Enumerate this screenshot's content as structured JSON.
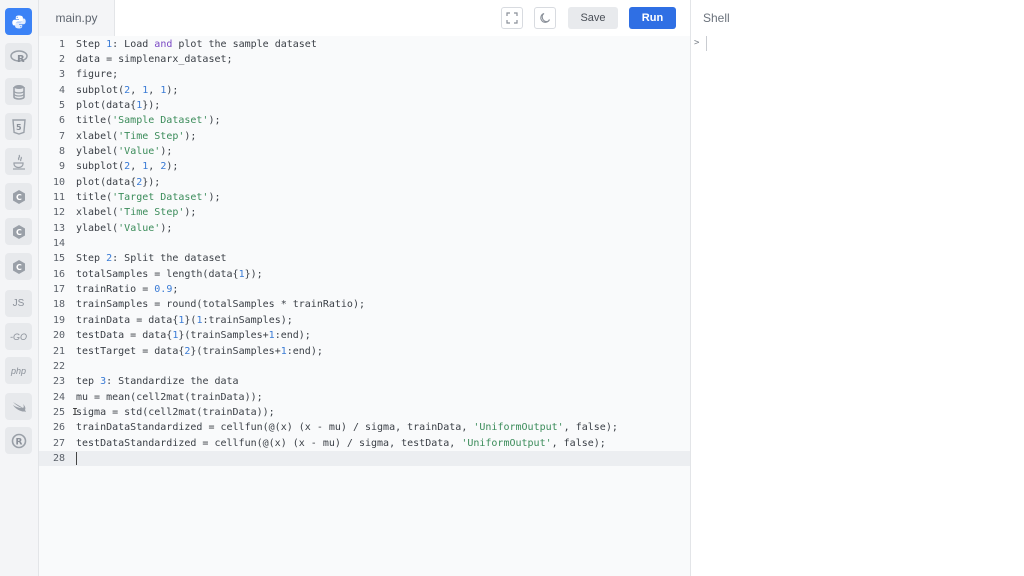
{
  "editor": {
    "file_tab": "main.py",
    "save_label": "Save",
    "run_label": "Run",
    "lines": [
      {
        "n": "1",
        "segs": [
          {
            "t": "Step "
          },
          {
            "t": "1",
            "c": "num"
          },
          {
            "t": ": Load "
          },
          {
            "t": "and",
            "c": "kw"
          },
          {
            "t": " plot the sample dataset"
          }
        ]
      },
      {
        "n": "2",
        "segs": [
          {
            "t": "data = simplenarx_dataset;"
          }
        ]
      },
      {
        "n": "3",
        "segs": [
          {
            "t": "figure;"
          }
        ]
      },
      {
        "n": "4",
        "segs": [
          {
            "t": "subplot("
          },
          {
            "t": "2",
            "c": "num"
          },
          {
            "t": ", "
          },
          {
            "t": "1",
            "c": "num"
          },
          {
            "t": ", "
          },
          {
            "t": "1",
            "c": "num"
          },
          {
            "t": ");"
          }
        ]
      },
      {
        "n": "5",
        "segs": [
          {
            "t": "plot(data{"
          },
          {
            "t": "1",
            "c": "num"
          },
          {
            "t": "});"
          }
        ]
      },
      {
        "n": "6",
        "segs": [
          {
            "t": "title("
          },
          {
            "t": "'Sample Dataset'",
            "c": "str"
          },
          {
            "t": ");"
          }
        ]
      },
      {
        "n": "7",
        "segs": [
          {
            "t": "xlabel("
          },
          {
            "t": "'Time Step'",
            "c": "str"
          },
          {
            "t": ");"
          }
        ]
      },
      {
        "n": "8",
        "segs": [
          {
            "t": "ylabel("
          },
          {
            "t": "'Value'",
            "c": "str"
          },
          {
            "t": ");"
          }
        ]
      },
      {
        "n": "9",
        "segs": [
          {
            "t": "subplot("
          },
          {
            "t": "2",
            "c": "num"
          },
          {
            "t": ", "
          },
          {
            "t": "1",
            "c": "num"
          },
          {
            "t": ", "
          },
          {
            "t": "2",
            "c": "num"
          },
          {
            "t": ");"
          }
        ]
      },
      {
        "n": "10",
        "segs": [
          {
            "t": "plot(data{"
          },
          {
            "t": "2",
            "c": "num"
          },
          {
            "t": "});"
          }
        ]
      },
      {
        "n": "11",
        "segs": [
          {
            "t": "title("
          },
          {
            "t": "'Target Dataset'",
            "c": "str"
          },
          {
            "t": ");"
          }
        ]
      },
      {
        "n": "12",
        "segs": [
          {
            "t": "xlabel("
          },
          {
            "t": "'Time Step'",
            "c": "str"
          },
          {
            "t": ");"
          }
        ]
      },
      {
        "n": "13",
        "segs": [
          {
            "t": "ylabel("
          },
          {
            "t": "'Value'",
            "c": "str"
          },
          {
            "t": ");"
          }
        ]
      },
      {
        "n": "14",
        "segs": [
          {
            "t": ""
          }
        ]
      },
      {
        "n": "15",
        "segs": [
          {
            "t": "Step "
          },
          {
            "t": "2",
            "c": "num"
          },
          {
            "t": ": Split the dataset"
          }
        ]
      },
      {
        "n": "16",
        "segs": [
          {
            "t": "totalSamples = length(data{"
          },
          {
            "t": "1",
            "c": "num"
          },
          {
            "t": "});"
          }
        ]
      },
      {
        "n": "17",
        "segs": [
          {
            "t": "trainRatio = "
          },
          {
            "t": "0.9",
            "c": "num"
          },
          {
            "t": ";"
          }
        ]
      },
      {
        "n": "18",
        "segs": [
          {
            "t": "trainSamples = round(totalSamples * trainRatio);"
          }
        ]
      },
      {
        "n": "19",
        "segs": [
          {
            "t": "trainData = data{"
          },
          {
            "t": "1",
            "c": "num"
          },
          {
            "t": "}("
          },
          {
            "t": "1",
            "c": "num"
          },
          {
            "t": ":trainSamples);"
          }
        ]
      },
      {
        "n": "20",
        "segs": [
          {
            "t": "testData = data{"
          },
          {
            "t": "1",
            "c": "num"
          },
          {
            "t": "}(trainSamples+"
          },
          {
            "t": "1",
            "c": "num"
          },
          {
            "t": ":end);"
          }
        ]
      },
      {
        "n": "21",
        "segs": [
          {
            "t": "testTarget = data{"
          },
          {
            "t": "2",
            "c": "num"
          },
          {
            "t": "}(trainSamples+"
          },
          {
            "t": "1",
            "c": "num"
          },
          {
            "t": ":end);"
          }
        ]
      },
      {
        "n": "22",
        "segs": [
          {
            "t": ""
          }
        ]
      },
      {
        "n": "23",
        "segs": [
          {
            "t": "tep "
          },
          {
            "t": "3",
            "c": "num"
          },
          {
            "t": ": Standardize the data"
          }
        ]
      },
      {
        "n": "24",
        "segs": [
          {
            "t": "mu = mean(cell2mat(trainData));"
          }
        ]
      },
      {
        "n": "25",
        "segs": [
          {
            "t": "sigma = std(cell2mat(trainData));"
          }
        ]
      },
      {
        "n": "26",
        "segs": [
          {
            "t": "trainDataStandardized = cellfun(@(x) (x - mu) / sigma, trainData, "
          },
          {
            "t": "'UniformOutput'",
            "c": "str"
          },
          {
            "t": ", false);"
          }
        ]
      },
      {
        "n": "27",
        "segs": [
          {
            "t": "testDataStandardized = cellfun(@(x) (x - mu) / sigma, testData, "
          },
          {
            "t": "'UniformOutput'",
            "c": "str"
          },
          {
            "t": ", false);"
          }
        ]
      },
      {
        "n": "28",
        "segs": [
          {
            "t": ""
          }
        ]
      }
    ],
    "current_line": 28
  },
  "shell": {
    "title": "Shell",
    "prompt": ">"
  },
  "sidebar": {
    "items": [
      {
        "name": "python-icon",
        "active": true
      },
      {
        "name": "r-icon"
      },
      {
        "name": "database-icon"
      },
      {
        "name": "html5-icon"
      },
      {
        "name": "java-icon"
      },
      {
        "name": "c-icon"
      },
      {
        "name": "cpp-icon"
      },
      {
        "name": "csharp-icon"
      },
      {
        "name": "javascript-icon",
        "text": "JS"
      },
      {
        "name": "go-icon",
        "text": "-GO"
      },
      {
        "name": "php-icon",
        "text": "php"
      },
      {
        "name": "swift-icon"
      },
      {
        "name": "rust-icon"
      }
    ]
  },
  "colors": {
    "accent": "#2f6fe4",
    "sidebar_active": "#3b82f6"
  }
}
